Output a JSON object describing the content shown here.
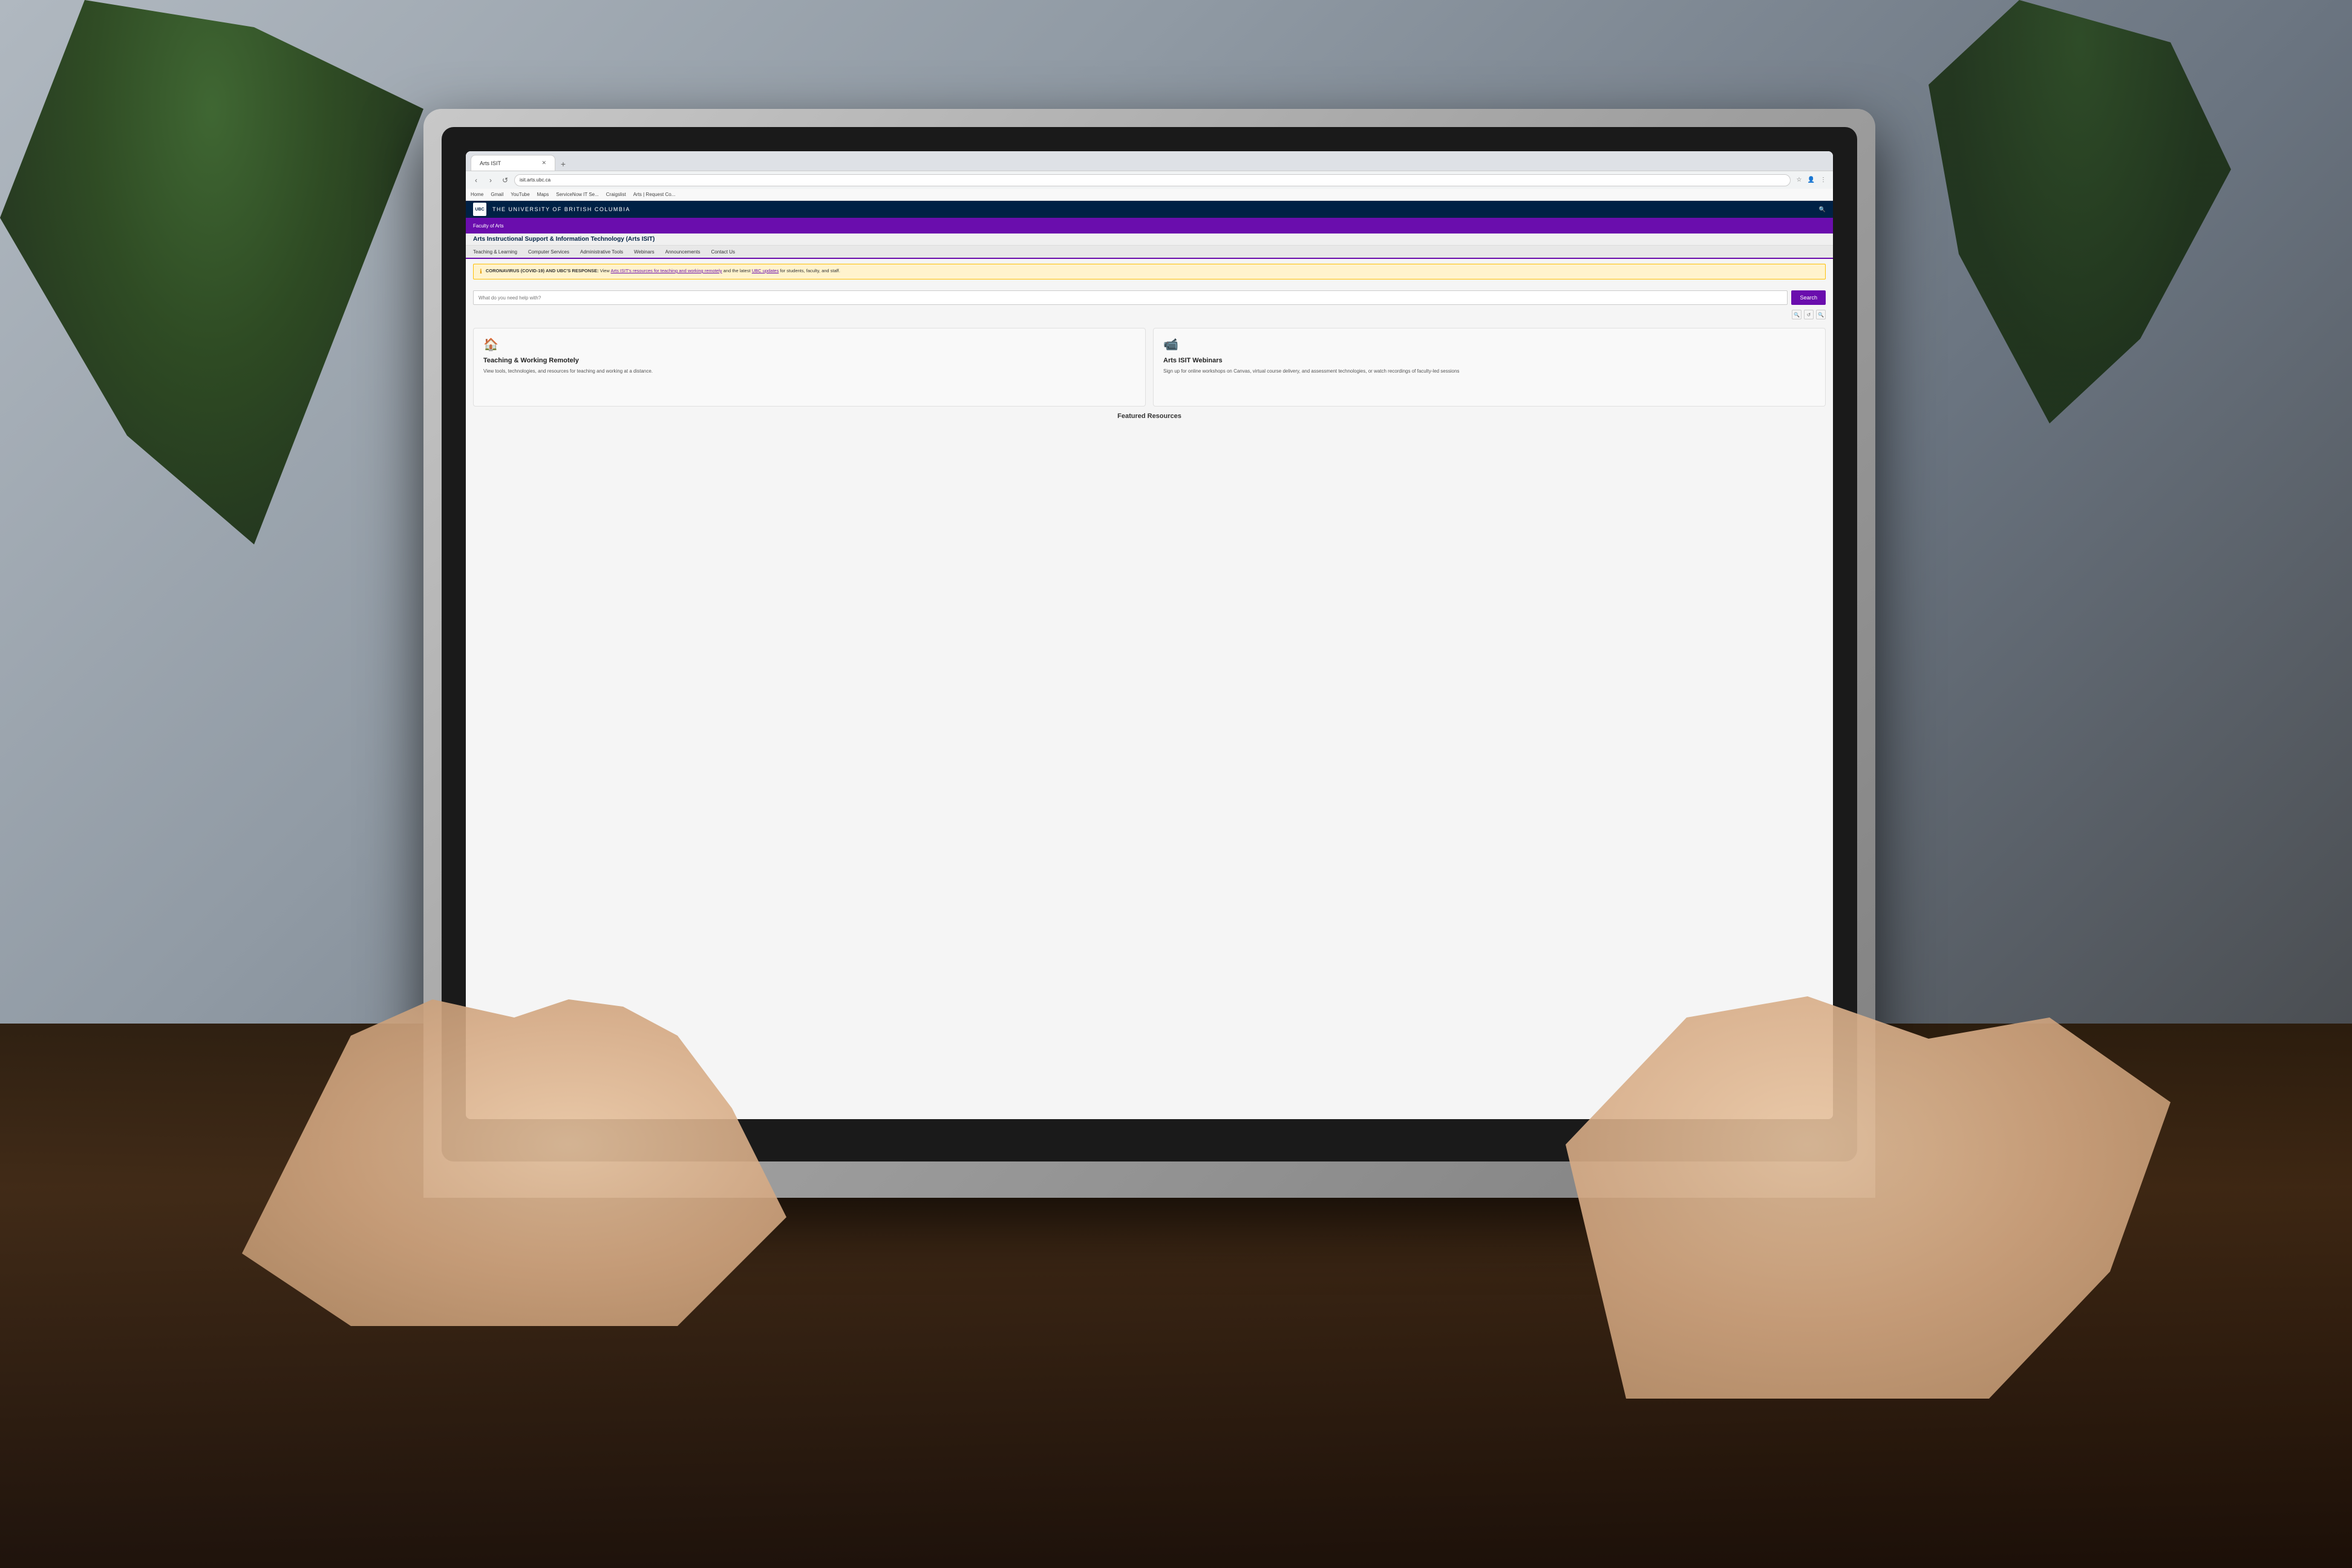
{
  "scene": {
    "background": "photo of person typing on laptop at dark desk"
  },
  "browser": {
    "tabs": [
      {
        "label": "Arts ISIT",
        "active": true,
        "url": "isit.arts.ubc.ca"
      },
      {
        "label": "+",
        "active": false
      }
    ],
    "url": "isit.arts.ubc.ca",
    "bookmarks": [
      "Home",
      "Gmail",
      "YouTube",
      "Maps",
      "ServiceNow IT Se...",
      "Craigslist",
      "Arts | Request Co..."
    ]
  },
  "website": {
    "ubc_topbar": {
      "logo": "UBC",
      "title": "THE UNIVERSITY OF BRITISH COLUMBIA"
    },
    "purple_bar": {
      "breadcrumb": "Faculty of Arts"
    },
    "isit_title": "Arts Instructional Support & Information Technology (Arts ISIT)",
    "nav_items": [
      "Teaching & Learning",
      "Computer Services",
      "Administrative Tools",
      "Webinars",
      "Announcements",
      "Contact Us"
    ],
    "alert": {
      "title": "CORONAVIRUS (COVID-19) AND UBC'S RESPONSE:",
      "text": "View Arts ISIT's resources for teaching and working remotely and the latest UBC updates for students, faculty, and staff."
    },
    "search": {
      "placeholder": "What do you need help with?",
      "button_label": "Search"
    },
    "cards": [
      {
        "icon": "🏠",
        "title": "Teaching & Working Remotely",
        "text": "View tools, technologies, and resources for teaching and working at a distance."
      },
      {
        "icon": "📹",
        "title": "Arts ISIT Webinars",
        "text": "Sign up for online workshops on Canvas, virtual course delivery, and assessment technologies, or watch recordings of faculty-led sessions"
      }
    ],
    "featured_section": {
      "title": "Featured Resources"
    }
  }
}
